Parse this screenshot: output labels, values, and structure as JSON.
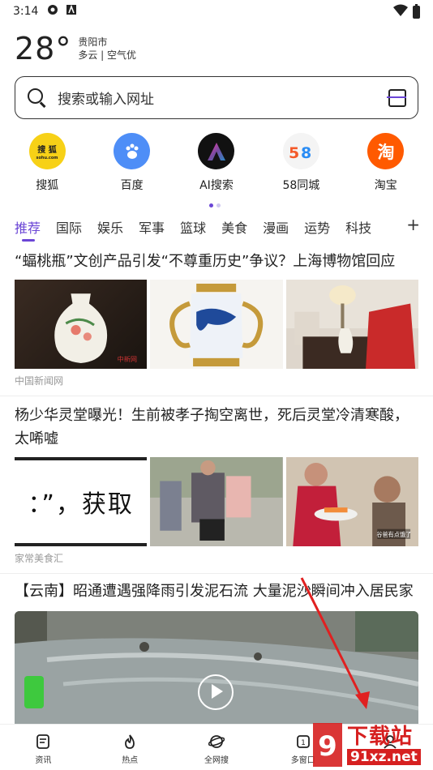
{
  "status_bar": {
    "time": "3:14"
  },
  "weather": {
    "temp": "28°",
    "city": "贵阳市",
    "condition": "多云 | 空气优"
  },
  "search": {
    "placeholder": "搜索或输入网址"
  },
  "quick_links": [
    {
      "label": "搜狐",
      "icon": "sohu-logo-icon",
      "color": "#f7d117"
    },
    {
      "label": "百度",
      "icon": "baidu-paw-icon",
      "color": "#4e8ef7"
    },
    {
      "label": "AI搜索",
      "icon": "ai-search-icon",
      "color": "#111111"
    },
    {
      "label": "58同城",
      "icon": "58-logo-icon",
      "color": "#f4f4f4"
    },
    {
      "label": "淘宝",
      "icon": "taobao-icon",
      "color": "#ff5a00"
    }
  ],
  "tabs": [
    "推荐",
    "国际",
    "娱乐",
    "军事",
    "篮球",
    "美食",
    "漫画",
    "运势",
    "科技"
  ],
  "tab_add": "+",
  "news": [
    {
      "title": "“蝠桃瓶”文创产品引发“不尊重历史”争议？上海博物馆回应",
      "source": "中国新闻网"
    },
    {
      "title": "杨少华灵堂曝光！生前被孝子掏空离世，死后灵堂冷清寒酸，太唏嘘",
      "source": "家常美食汇",
      "thumb_text": "：”，获取"
    },
    {
      "title": "【云南】昭通遭遇强降雨引发泥石流 大量泥沙瞬间冲入居民家"
    }
  ],
  "bottom_nav": [
    {
      "label": "资讯",
      "icon": "news-doc-icon"
    },
    {
      "label": "热点",
      "icon": "flame-icon"
    },
    {
      "label": "全网搜",
      "icon": "planet-icon"
    },
    {
      "label": "多窗口",
      "icon": "windows-icon"
    },
    {
      "label": "我的",
      "icon": "profile-icon"
    }
  ],
  "watermark": {
    "text": "下载站",
    "url": "91xz.net"
  },
  "colors": {
    "accent": "#6b46d6",
    "watermark": "#d62020"
  }
}
